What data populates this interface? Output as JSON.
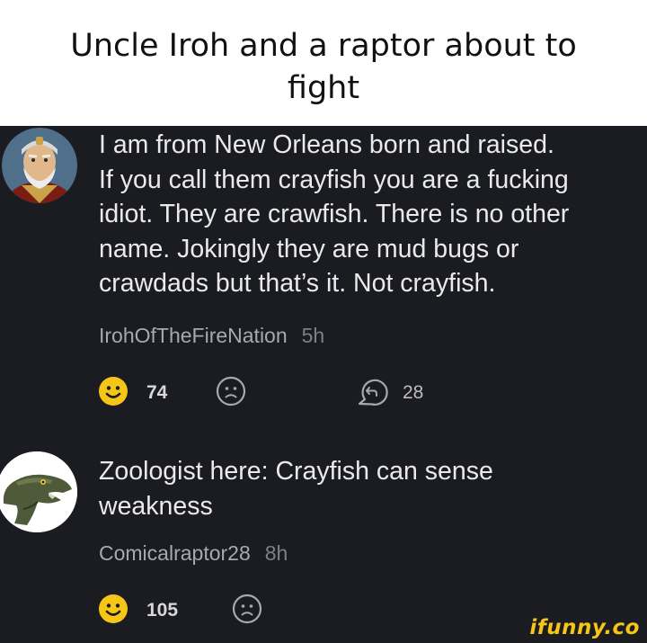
{
  "caption": {
    "line1": "Uncle Iroh and a raptor about to",
    "line2": "fight"
  },
  "comments": [
    {
      "text_lines": [
        "I am from New Orleans born and raised.",
        "If you call them crayfish you are a fucking",
        "idiot. They are crawfish. There is no other",
        "name. Jokingly they are mud bugs or",
        "crawdads but that’s it. Not crayfish."
      ],
      "username": "IrohOfTheFireNation",
      "time": "5h",
      "likes": "74",
      "replies": "28"
    },
    {
      "text_lines": [
        "Zoologist here: Crayfish can sense",
        "weakness"
      ],
      "username": "Comicalraptor28",
      "time": "8h",
      "likes": "105"
    }
  ],
  "watermark": "ifunny.co",
  "colors": {
    "background": "#1b1c21",
    "like_yellow": "#f5c518",
    "text": "#eaeaea",
    "meta": "#a7a9ae"
  }
}
